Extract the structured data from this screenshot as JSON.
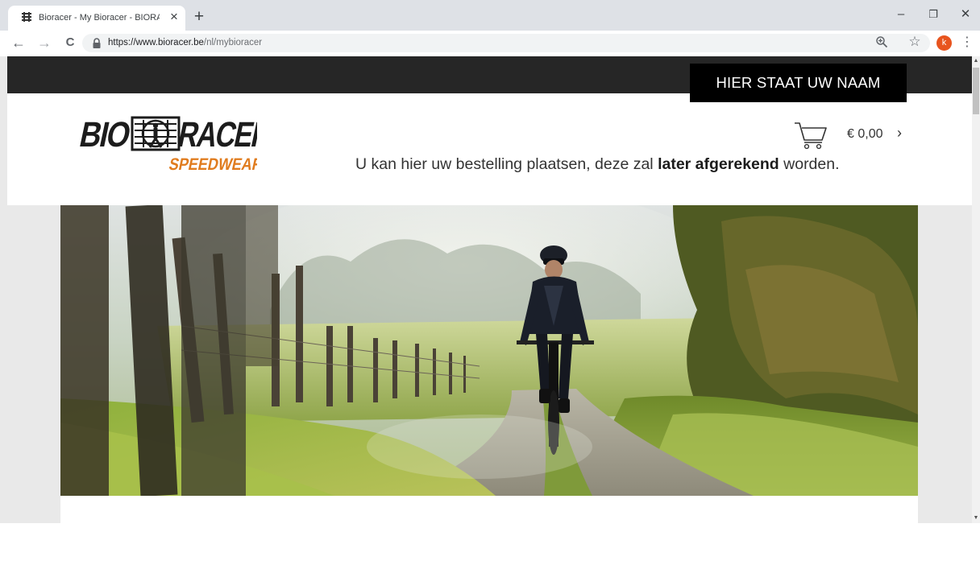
{
  "browser": {
    "tab_title": "Bioracer - My Bioracer - BIORACER",
    "tab_close": "×",
    "new_tab": "+",
    "window_minimize": "–",
    "window_restore": "❐",
    "window_close": "✕",
    "back": "←",
    "forward": "→",
    "reload": "C",
    "url_host": "https://www.bioracer.be",
    "url_path": "/nl/mybioracer",
    "bookmark_star": "☆",
    "profile_initial": "k",
    "menu": "⋮",
    "icons": [
      "favicon-icon",
      "lock-icon",
      "zoom-icon",
      "star-icon",
      "kebab-menu-icon"
    ]
  },
  "page": {
    "name_banner": "HIER STAAT UW NAAM",
    "logo": {
      "wordmark_left": "BIO",
      "wordmark_right": "RACER",
      "tagline": "SPEEDWEAR",
      "accent_color": "#e07c1f",
      "ink_color": "#1c1c1c"
    },
    "cart": {
      "total": "€ 0,00",
      "chevron": "›"
    },
    "notice": {
      "before": "U kan hier uw bestelling plaatsen, deze zal ",
      "bold": "later afgerekend",
      "after": " worden."
    },
    "hero": {
      "subject": "cyclist on gravel path",
      "colors": [
        "#8fae3e",
        "#3c4a1c",
        "#cfd6c9",
        "#1a1f2a"
      ]
    }
  },
  "scrollbar": {
    "up": "▲",
    "down": "▼"
  }
}
